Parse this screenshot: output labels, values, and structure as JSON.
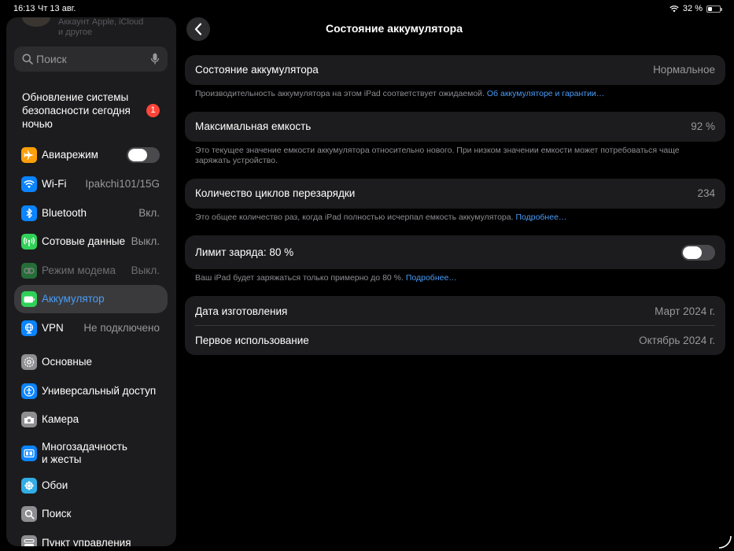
{
  "status_bar": {
    "time": "16:13",
    "date": "Чт 13 авг.",
    "battery_percent": "32 %"
  },
  "sidebar": {
    "account_subtitle_line1": "Аккаунт Apple, iCloud",
    "account_subtitle_line2": "и другое",
    "search_placeholder": "Поиск",
    "update": {
      "label": "Обновление системы безопасности сегодня ночью",
      "badge": "1"
    },
    "items": [
      {
        "label": "Авиарежим",
        "value": "",
        "icon": "airplane-icon",
        "color": "#ff9f0a",
        "toggle": "off"
      },
      {
        "label": "Wi-Fi",
        "value": "Ipakchi101/15G",
        "icon": "wifi-icon",
        "color": "#0a84ff"
      },
      {
        "label": "Bluetooth",
        "value": "Вкл.",
        "icon": "bluetooth-icon",
        "color": "#0a84ff"
      },
      {
        "label": "Сотовые данные",
        "value": "Выкл.",
        "icon": "antenna-icon",
        "color": "#30d158"
      },
      {
        "label": "Режим модема",
        "value": "Выкл.",
        "icon": "link-icon",
        "color": "#30d158"
      },
      {
        "label": "Аккумулятор",
        "value": "",
        "icon": "battery-icon",
        "color": "#30d158"
      },
      {
        "label": "VPN",
        "value": "Не подключено",
        "icon": "globe-icon",
        "color": "#0a84ff"
      },
      {
        "label": "Основные",
        "value": "",
        "icon": "gear-icon",
        "color": "#8e8e93"
      },
      {
        "label": "Универсальный доступ",
        "value": "",
        "icon": "accessibility-icon",
        "color": "#0a84ff"
      },
      {
        "label": "Камера",
        "value": "",
        "icon": "camera-icon",
        "color": "#8e8e93"
      },
      {
        "label": "Многозадачность и жесты",
        "line1": "Многозадачность",
        "line2": "и жесты",
        "value": "",
        "icon": "multitasking-icon",
        "color": "#0a84ff"
      },
      {
        "label": "Обои",
        "value": "",
        "icon": "wallpaper-icon",
        "color": "#32ade6"
      },
      {
        "label": "Поиск",
        "value": "",
        "icon": "search-icon",
        "color": "#8e8e93"
      },
      {
        "label": "Пункт управления",
        "value": "",
        "icon": "control-center-icon",
        "color": "#8e8e93"
      }
    ]
  },
  "main": {
    "title": "Состояние аккумулятора",
    "health": {
      "label": "Состояние аккумулятора",
      "value": "Нормальное",
      "note": "Производительность аккумулятора на этом iPad соответствует ожидаемой.",
      "link": "Об аккумуляторе и гарантии…"
    },
    "capacity": {
      "label": "Максимальная емкость",
      "value": "92 %",
      "note": "Это текущее значение емкости аккумулятора относительно нового. При низком значении емкости может потребоваться чаще заряжать устройство."
    },
    "cycles": {
      "label": "Количество циклов перезарядки",
      "value": "234",
      "note": "Это общее количество раз, когда iPad полностью исчерпал емкость аккумулятора.",
      "link": "Подробнее…"
    },
    "limit": {
      "label": "Лимит заряда: 80 %",
      "toggle": "off",
      "note": "Ваш iPad будет заряжаться только примерно до 80 %.",
      "link": "Подробнее…"
    },
    "dates": {
      "manufactured_label": "Дата изготовления",
      "manufactured_value": "Март 2024 г.",
      "first_use_label": "Первое использование",
      "first_use_value": "Октябрь 2024 г."
    }
  },
  "colors": {
    "accent": "#4a9df8",
    "badge": "#ff453a",
    "card": "#1c1c1e"
  }
}
